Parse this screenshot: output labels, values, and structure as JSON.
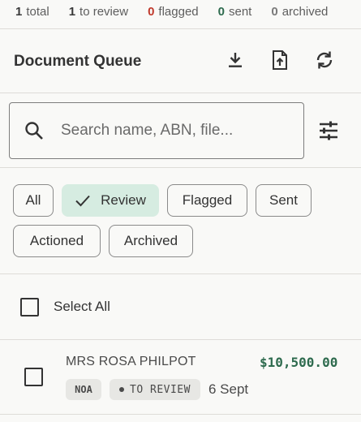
{
  "stats": [
    {
      "num": "1",
      "label": "total",
      "tone": "dark"
    },
    {
      "num": "1",
      "label": "to review",
      "tone": "dark"
    },
    {
      "num": "0",
      "label": "flagged",
      "tone": "red"
    },
    {
      "num": "0",
      "label": "sent",
      "tone": "green"
    },
    {
      "num": "0",
      "label": "archived",
      "tone": "grey"
    }
  ],
  "header": {
    "title": "Document Queue",
    "icons": [
      "download-icon",
      "upload-file-icon",
      "refresh-icon"
    ]
  },
  "search": {
    "placeholder": "Search name, ABN, file...",
    "value": ""
  },
  "filters": [
    {
      "label": "All",
      "selected": false
    },
    {
      "label": "Review",
      "selected": true
    },
    {
      "label": "Flagged",
      "selected": false
    },
    {
      "label": "Sent",
      "selected": false
    },
    {
      "label": "Actioned",
      "selected": false
    },
    {
      "label": "Archived",
      "selected": false
    }
  ],
  "select_all": {
    "label": "Select All",
    "checked": false
  },
  "rows": [
    {
      "name": "MRS ROSA PHILPOT",
      "amount": "$10,500.00",
      "type_badge": "NOA",
      "status_badge": "TO REVIEW",
      "date": "6 Sept",
      "checked": false
    }
  ],
  "colors": {
    "accent_green": "#2e6b4e",
    "selected_chip_bg": "#d6ece1",
    "flag_red": "#c0392b"
  }
}
